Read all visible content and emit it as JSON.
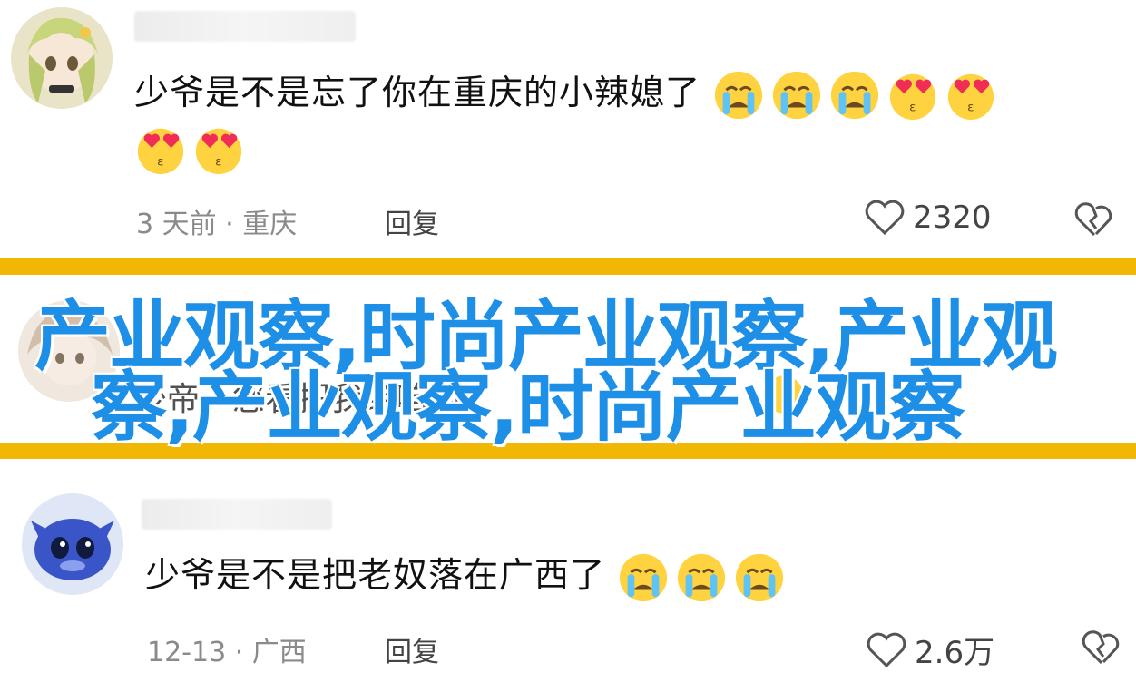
{
  "comments": [
    {
      "text": "少爷是不是忘了你在重庆的小辣媳了",
      "meta": "3 天前 · 重庆",
      "reply": "回复",
      "likes": "2320",
      "emojis": [
        "crying-face",
        "crying-face",
        "crying-face",
        "heart-eyes-face",
        "heart-eyes-face",
        "heart-eyes-face",
        "heart-eyes-face"
      ]
    },
    {
      "text": "少帝，您看把我给咱的",
      "note": "partially covered by banner"
    },
    {
      "text": "少爷是不是把老奴落在广西了",
      "meta": "12-13 · 广西",
      "reply": "回复",
      "likes": "2.6万",
      "emojis": [
        "crying-face",
        "crying-face",
        "crying-face"
      ]
    }
  ],
  "banner": {
    "line1": "产业观察,时尚产业观察,产业观",
    "line2": "察,产业观察,时尚产业观察"
  },
  "colors": {
    "stripe": "#f2b705",
    "banner_text": "#1e8fe6",
    "meta_text": "#8a8a8a"
  }
}
